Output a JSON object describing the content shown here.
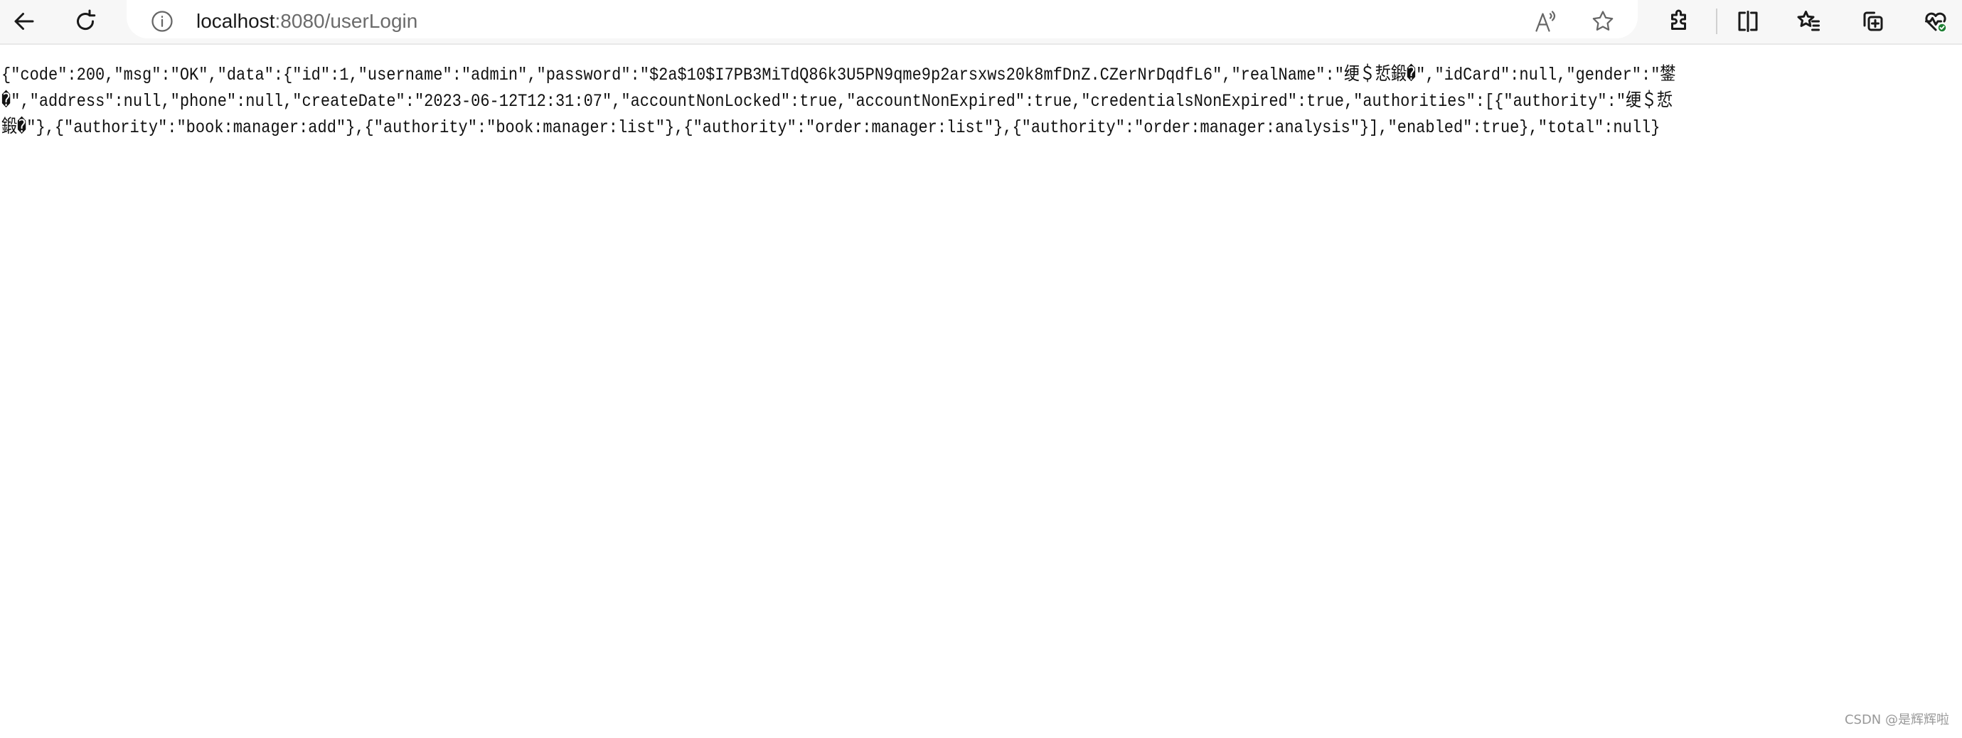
{
  "browser": {
    "url_host": "localhost",
    "url_rest": ":8080/userLogin",
    "icons": [
      "back-icon",
      "refresh-icon",
      "site-info-icon",
      "read-aloud-icon",
      "favorite-star-icon",
      "extensions-icon",
      "split-screen-icon",
      "favorites-list-icon",
      "collections-icon",
      "browser-essentials-icon"
    ],
    "status_color": "#1e7f34"
  },
  "page": {
    "body_text": "{\"code\":200,\"msg\":\"OK\",\"data\":{\"id\":1,\"username\":\"admin\",\"password\":\"$2a$10$I7PB3MiTdQ86k3U5PN9qme9p2arsxws20k8mfDnZ.CZerNrDqdfL6\",\"realName\":\"绠＄悊鍛�\",\"idCard\":null,\"gender\":\"鐢�\",\"address\":null,\"phone\":null,\"createDate\":\"2023-06-12T12:31:07\",\"accountNonLocked\":true,\"accountNonExpired\":true,\"credentialsNonExpired\":true,\"authorities\":[{\"authority\":\"绠＄悊鍛�\"},{\"authority\":\"book:manager:add\"},{\"authority\":\"book:manager:list\"},{\"authority\":\"order:manager:list\"},{\"authority\":\"order:manager:analysis\"}],\"enabled\":true},\"total\":null}"
  },
  "watermark": "CSDN @是辉辉啦"
}
